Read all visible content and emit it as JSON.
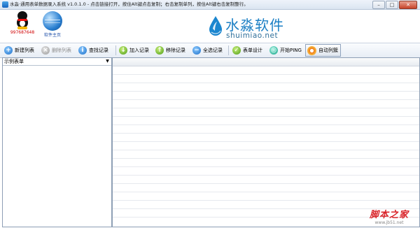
{
  "window": {
    "title": "水淼·通用表单数据录入系统 v1.0.1.0 - 点击链接打开，按住Alt键点击复制；右击复制单列，按住Alt键右击复制整行。",
    "minimize_glyph": "–",
    "maximize_glyph": "□",
    "close_glyph": "✕"
  },
  "header": {
    "qq_label": "997687648",
    "homepage_label": "软件主页",
    "logo_cn": "水淼软件",
    "logo_en": "shuimiao.net",
    "colors": {
      "qq_label": "#d00000",
      "homepage_label": "#1f4fa8",
      "logo": "#1b7fc4"
    }
  },
  "toolbar": {
    "new_list": "新建列表",
    "delete_list": "删除列表",
    "find_record": "查找记录",
    "add_record": "加入记录",
    "remove_record": "移除记录",
    "select_all": "全选记录",
    "form_design": "表单设计",
    "start_ping": "开始PING",
    "auto_list": "自动列簇"
  },
  "left_panel": {
    "combo_value": "示例表单"
  },
  "watermark": {
    "cn": "脚本之家",
    "url": "www.jb51.net"
  }
}
